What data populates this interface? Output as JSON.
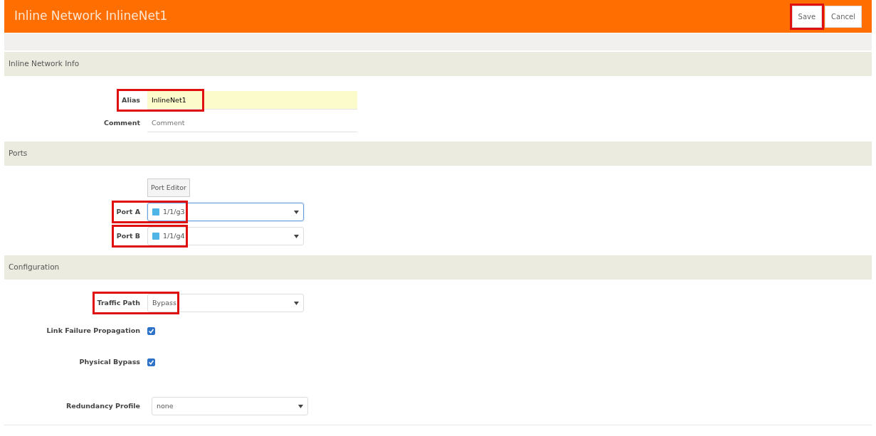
{
  "header": {
    "title": "Inline Network InlineNet1",
    "buttons": [
      {
        "label": "Save",
        "highlighted": true
      },
      {
        "label": "Cancel",
        "highlighted": false
      }
    ]
  },
  "sections": [
    {
      "title": "Inline Network Info",
      "fields": [
        {
          "kind": "text",
          "label": "Alias",
          "value": "InlineNet1",
          "highlighted": true
        },
        {
          "kind": "text",
          "label": "Comment",
          "placeholder": "Comment",
          "highlighted": false
        }
      ]
    },
    {
      "title": "Ports",
      "fields": [
        {
          "kind": "button",
          "label": "Port Editor"
        },
        {
          "kind": "select",
          "label": "Port A",
          "value": "1/1/g3",
          "focused": true,
          "highlighted": true
        },
        {
          "kind": "select",
          "label": "Port B",
          "value": "1/1/g4",
          "focused": false,
          "highlighted": true
        }
      ]
    },
    {
      "title": "Configuration",
      "fields": [
        {
          "kind": "select",
          "label": "Traffic Path",
          "value": "Bypass",
          "focused": false,
          "highlighted": true
        },
        {
          "kind": "checkbox",
          "label": "Link Failure Propagation",
          "checked": true
        },
        {
          "kind": "checkbox",
          "label": "Physical Bypass",
          "checked": true
        },
        {
          "kind": "select",
          "label": "Redundancy Profile",
          "value": "none",
          "focused": false,
          "highlighted": false
        }
      ]
    }
  ]
}
